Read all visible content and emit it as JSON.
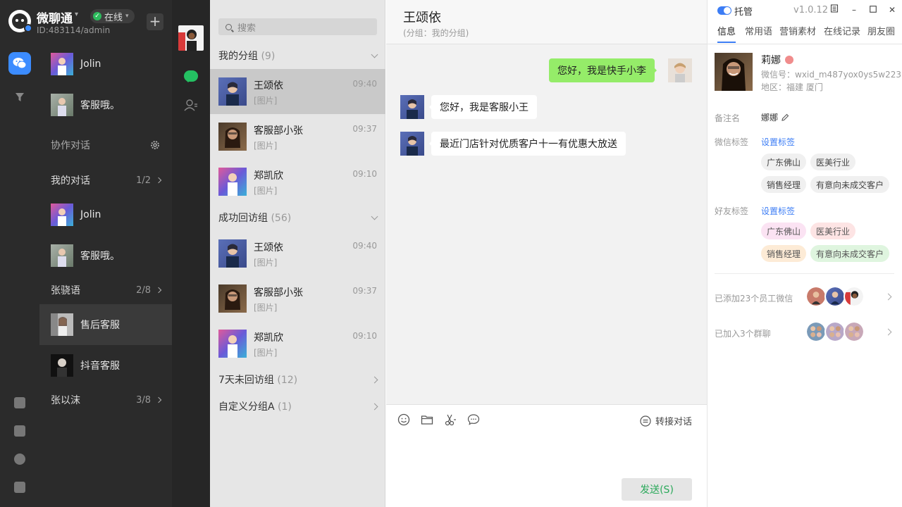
{
  "app": {
    "name": "微聊通",
    "status": "在线",
    "id_text": "ID:483114/admin"
  },
  "sidebar": {
    "top_conversations": [
      {
        "label": "Jolin"
      },
      {
        "label": "客服哦。"
      }
    ],
    "collab_label": "协作对话",
    "my_conversations": {
      "label": "我的对话",
      "count": "1/2"
    },
    "my_items": [
      {
        "label": "Jolin"
      },
      {
        "label": "客服哦。"
      }
    ],
    "groups": [
      {
        "label": "张骁语",
        "count": "2/8"
      },
      {
        "label": "张以沫",
        "count": "3/8"
      }
    ],
    "group_items": [
      {
        "label": "售后客服"
      },
      {
        "label": "抖音客服"
      }
    ]
  },
  "search": {
    "placeholder": "搜索"
  },
  "group_list": {
    "groups": [
      {
        "name": "我的分组",
        "count": "(9)",
        "items": [
          {
            "name": "王颂依",
            "preview": "[图片]",
            "time": "09:40"
          },
          {
            "name": "客服部小张",
            "preview": "[图片]",
            "time": "09:37"
          },
          {
            "name": "郑凯欣",
            "preview": "[图片]",
            "time": "09:10"
          }
        ]
      },
      {
        "name": "成功回访组",
        "count": "(56)",
        "items": [
          {
            "name": "王颂依",
            "preview": "[图片]",
            "time": "09:40"
          },
          {
            "name": "客服部小张",
            "preview": "[图片]",
            "time": "09:37"
          },
          {
            "name": "郑凯欣",
            "preview": "[图片]",
            "time": "09:10"
          }
        ]
      },
      {
        "name": "7天未回访组",
        "count": "(12)"
      },
      {
        "name": "自定义分组A",
        "count": "(1)"
      }
    ]
  },
  "chat": {
    "title": "王颂依",
    "subtitle": "(分组：我的分组)",
    "messages": [
      {
        "from": "me",
        "text": "您好，我是快手小李"
      },
      {
        "from": "them",
        "text": "您好，我是客服小王"
      },
      {
        "from": "them",
        "text": "最近门店针对优质客户十一有优惠大放送"
      }
    ],
    "transfer_label": "转接对话",
    "send_label": "发送(S)"
  },
  "info": {
    "toggle_label": "托管",
    "version": "v1.0.12",
    "tabs": [
      "信息",
      "常用语",
      "营销素材",
      "在线记录",
      "朋友圈"
    ],
    "profile": {
      "name": "莉娜",
      "wechat_id": "微信号：wxid_m487yox0ys5w223",
      "region": "地区：福建 厦门"
    },
    "remark_label": "备注名",
    "remark_value": "娜娜",
    "wechat_tags_label": "微信标签",
    "set_tags_label": "设置标签",
    "wechat_tags": [
      "广东佛山",
      "医美行业",
      "销售经理",
      "有意向未成交客户"
    ],
    "friend_tags_label": "好友标签",
    "friend_tags": [
      "广东佛山",
      "医美行业",
      "销售经理",
      "有意向未成交客户"
    ],
    "added_staff": "已添加23个员工微信",
    "joined_groups": "已加入3个群聊"
  },
  "colors": {
    "accent": "#3c7df5",
    "bubble_me": "#95ec69",
    "online": "#2dbb5d",
    "sidebar_bg": "#2b2b2b"
  }
}
